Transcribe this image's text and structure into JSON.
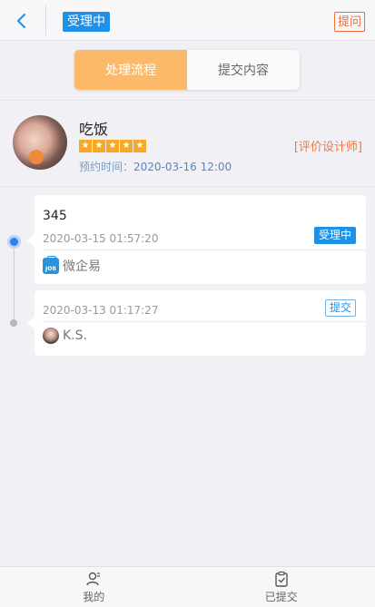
{
  "header": {
    "status": "受理中",
    "ask_label": "提问"
  },
  "tabs": [
    {
      "label": "处理流程",
      "active": true
    },
    {
      "label": "提交内容",
      "active": false
    }
  ],
  "designer": {
    "name": "吃饭",
    "rating": 5,
    "stars": [
      "★",
      "★",
      "★",
      "★",
      "★"
    ],
    "appointment_label": "预约时间：",
    "appointment_time": "2020-03-16 12:00",
    "rate_link": "[评价设计师]"
  },
  "timeline": [
    {
      "content": "345",
      "time": "2020-03-15 01:57:20",
      "badge": "受理中",
      "user": "微企易",
      "user_icon": "job-logo-icon"
    },
    {
      "content": "",
      "time": "2020-03-13 01:17:27",
      "badge": "提交",
      "user": "K.S.",
      "user_icon": "user-avatar"
    }
  ],
  "bottom_nav": [
    {
      "label": "我的",
      "icon": "user-icon"
    },
    {
      "label": "已提交",
      "icon": "clipboard-check-icon"
    }
  ],
  "colors": {
    "accent": "#1e90e6",
    "tab_active": "#fcb96a",
    "warning": "#f26b3a",
    "star": "#f9a825"
  }
}
